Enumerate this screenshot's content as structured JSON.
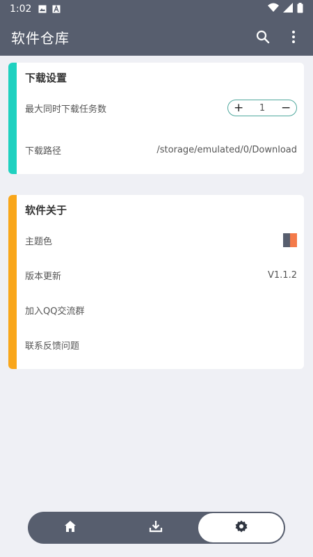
{
  "status_bar": {
    "time": "1:02"
  },
  "app_bar": {
    "title": "软件仓库"
  },
  "download_settings": {
    "title": "下载设置",
    "accent_color": "#1fd1c0",
    "max_tasks_label": "最大同时下载任务数",
    "max_tasks_value": "1",
    "path_label": "下载路径",
    "path_value": "/storage/emulated/0/Download"
  },
  "about": {
    "title": "软件关于",
    "accent_color": "#f9a61a",
    "theme_label": "主题色",
    "theme_colors": [
      "#575e6e",
      "#f47a4a"
    ],
    "version_label": "版本更新",
    "version_value": "V1.1.2",
    "qq_label": "加入QQ交流群",
    "feedback_label": "联系反馈问题"
  },
  "bottom_nav": {
    "items": [
      {
        "icon": "home-icon",
        "active": false
      },
      {
        "icon": "download-icon",
        "active": false
      },
      {
        "icon": "settings-icon",
        "active": true
      }
    ]
  }
}
